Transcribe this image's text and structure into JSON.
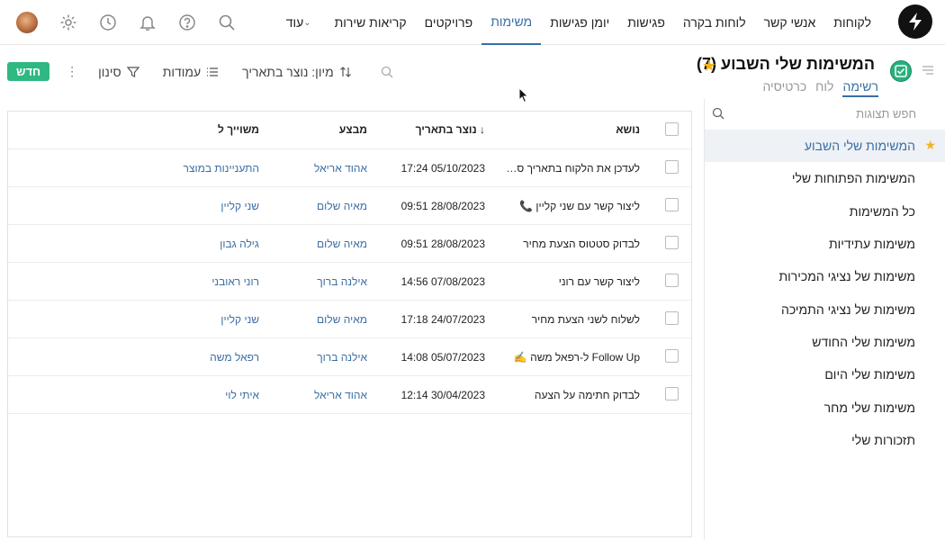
{
  "nav": {
    "items": [
      {
        "label": "לקוחות",
        "active": false
      },
      {
        "label": "אנשי קשר",
        "active": false
      },
      {
        "label": "לוחות בקרה",
        "active": false
      },
      {
        "label": "פגישות",
        "active": false
      },
      {
        "label": "יומן פגישות",
        "active": false
      },
      {
        "label": "משימות",
        "active": true
      },
      {
        "label": "פרויקטים",
        "active": false
      },
      {
        "label": "קריאות שירות",
        "active": false
      }
    ],
    "more_label": "עוד",
    "icons": [
      "search-icon",
      "help-icon",
      "bell-icon",
      "clock-icon",
      "gear-icon",
      "avatar"
    ]
  },
  "header": {
    "title": "המשימות שלי השבוע (7)",
    "view_tabs": [
      {
        "label": "רשימה",
        "active": true
      },
      {
        "label": "לוח",
        "active": false
      },
      {
        "label": "כרטיסיה",
        "active": false
      }
    ]
  },
  "toolbar": {
    "sort_label": "מיון: נוצר בתאריך",
    "columns_label": "עמודות",
    "filter_label": "סינון",
    "new_label": "חדש"
  },
  "sidebar": {
    "search_placeholder": "חפש תצוגות",
    "items": [
      {
        "label": "המשימות שלי השבוע",
        "active": true,
        "starred": true
      },
      {
        "label": "המשימות הפתוחות שלי"
      },
      {
        "label": "כל המשימות"
      },
      {
        "label": "משימות עתידיות"
      },
      {
        "label": "משימות של נציגי המכירות"
      },
      {
        "label": "משימות של נציגי התמיכה"
      },
      {
        "label": "משימות שלי החודש"
      },
      {
        "label": "משימות שלי היום"
      },
      {
        "label": "משימות שלי מחר"
      },
      {
        "label": "תזכורות שלי"
      }
    ]
  },
  "table": {
    "columns": {
      "subject": "נושא",
      "created": "↓ נוצר בתאריך",
      "executor": "מבצע",
      "assigned": "משוייך ל"
    },
    "rows": [
      {
        "subject": "לעדכן את הלקוח בתאריך סיום...",
        "created": "05/10/2023 17:24",
        "executor": "אהוד אריאל",
        "assigned": "התעניינות במוצר"
      },
      {
        "subject": "ליצור קשר עם שני קליין 📞",
        "created": "28/08/2023 09:51",
        "executor": "מאיה שלום",
        "assigned": "שני קליין"
      },
      {
        "subject": "לבדוק סטטוס הצעת מחיר",
        "created": "28/08/2023 09:51",
        "executor": "מאיה שלום",
        "assigned": "גילה גבון"
      },
      {
        "subject": "ליצור קשר עם רוני",
        "created": "07/08/2023 14:56",
        "executor": "אילנה ברוך",
        "assigned": "רוני ראובני"
      },
      {
        "subject": "לשלוח לשני הצעת מחיר",
        "created": "24/07/2023 17:18",
        "executor": "מאיה שלום",
        "assigned": "שני קליין"
      },
      {
        "subject": "Follow Up ל-רפאל משה ✍️",
        "created": "05/07/2023 14:08",
        "executor": "אילנה ברוך",
        "assigned": "רפאל משה"
      },
      {
        "subject": "לבדוק חתימה על הצעה",
        "created": "30/04/2023 12:14",
        "executor": "אהוד אריאל",
        "assigned": "איתי לוי"
      }
    ]
  }
}
